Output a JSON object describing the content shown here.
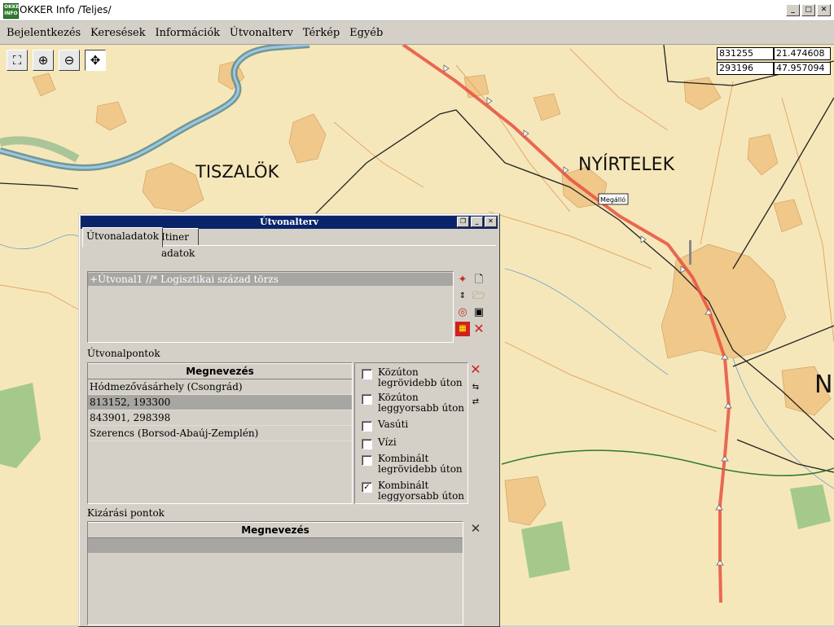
{
  "window": {
    "title": "OKKER Info /Teljes/",
    "app_icon": "okker-info-icon"
  },
  "menu": [
    "Bejelentkezés",
    "Keresések",
    "Információk",
    "Útvonalterv",
    "Térkép",
    "Egyéb"
  ],
  "toolbar": [
    "zoom-extent-icon",
    "zoom-in-icon",
    "zoom-out-icon",
    "pan-move-icon"
  ],
  "coords": {
    "x": "831255",
    "lon": "21.474608",
    "y": "293196",
    "lat": "47.957094"
  },
  "map": {
    "labels": {
      "tiszalok": "TISZALÖK",
      "nyirtelek": "NYÍRTELEK",
      "megallo": "Megálló",
      "n_fragment": "N"
    },
    "colors": {
      "background": "#f6e7ba",
      "settlement": "#f0c88a",
      "river": "#5a8a8a",
      "route": "#e85040"
    }
  },
  "dialog": {
    "title": "Útvonalterv",
    "tabs": [
      "Útvonaladatok",
      "Itiner adatok"
    ],
    "route_item": "+Útvonal1 //* Logisztikai század törzs",
    "routepoints_label": "Útvonalpontok",
    "grid_header": "Megnevezés",
    "routepoints": [
      "Hódmezővásárhely (Csongrád)",
      "813152, 193300",
      "843901, 298398",
      "Szerencs (Borsod-Abaúj-Zemplén)"
    ],
    "selected_row": 1,
    "options": [
      {
        "label1": "Közúton",
        "label2": "legrövidebb úton",
        "checked": ""
      },
      {
        "label1": "Közúton",
        "label2": "leggyorsabb úton",
        "checked": ""
      },
      {
        "label1": "Vasúti",
        "label2": "",
        "checked": ""
      },
      {
        "label1": "Vízi",
        "label2": "",
        "checked": ""
      },
      {
        "label1": "Kombinált",
        "label2": "legrövidebb úton",
        "checked": ""
      },
      {
        "label1": "Kombinált",
        "label2": "leggyorsabb úton",
        "checked": "✓"
      }
    ],
    "exclusion_label": "Kizárási pontok",
    "exclusion_header": "Megnevezés"
  }
}
